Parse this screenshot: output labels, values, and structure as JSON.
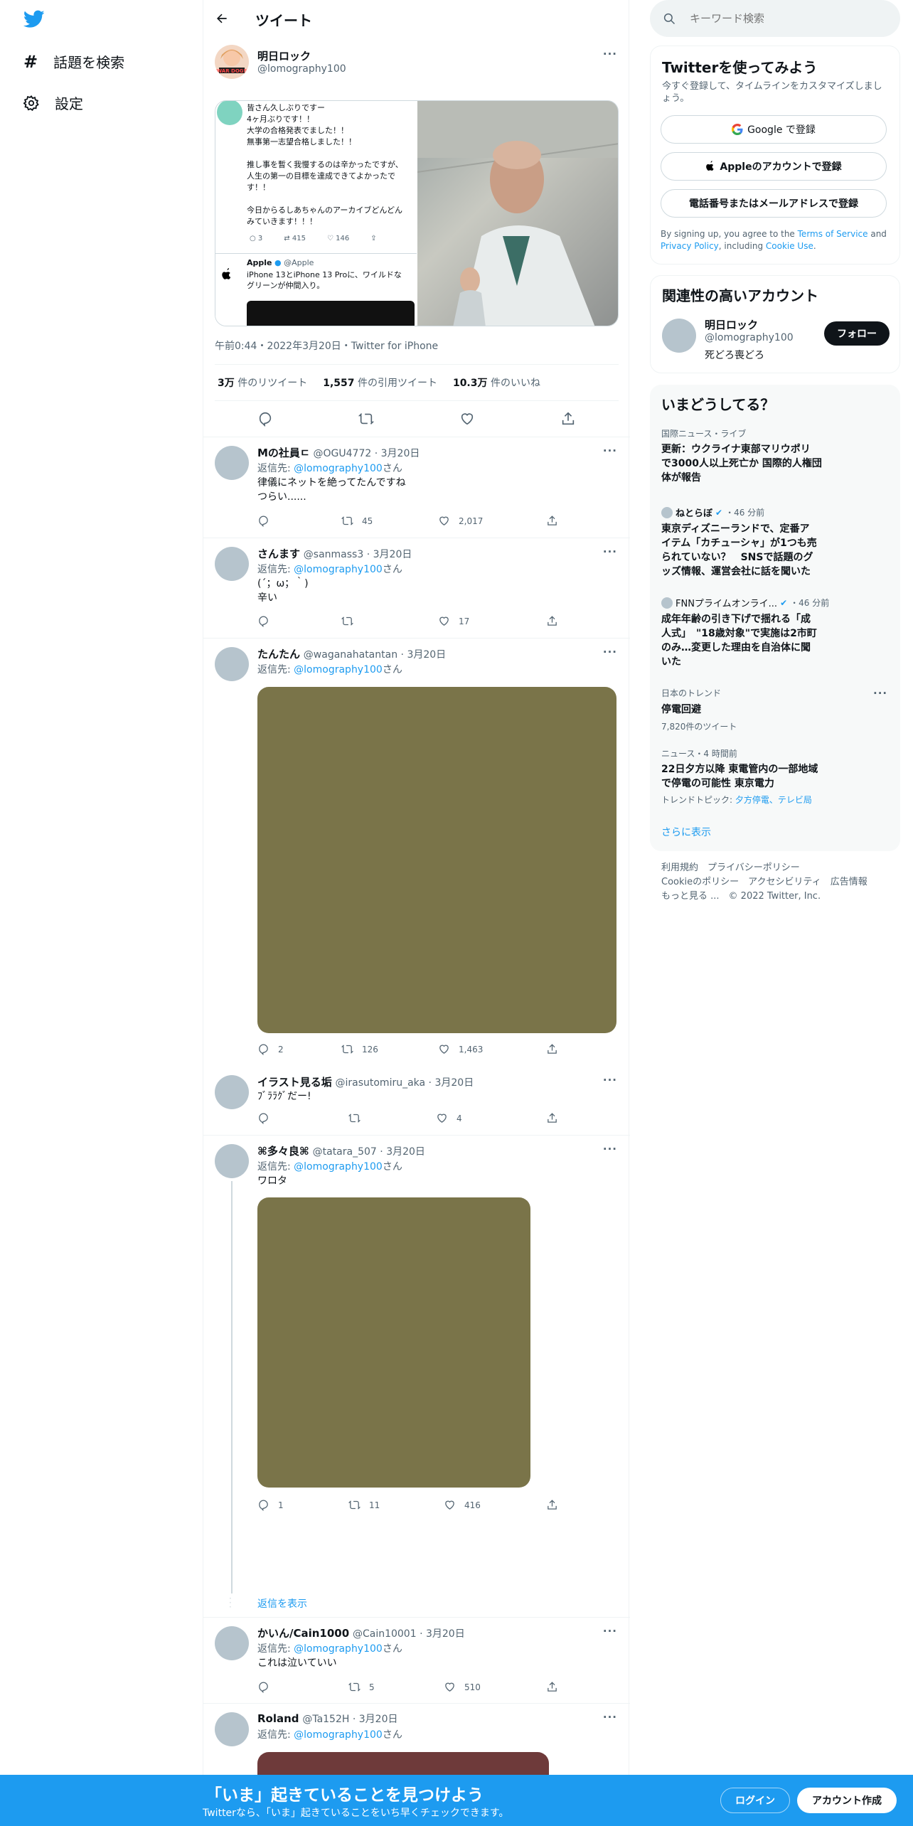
{
  "nav": {
    "explore_label": "話題を検索",
    "settings_label": "設定"
  },
  "header": {
    "title": "ツイート"
  },
  "tweet": {
    "author_name": "明日ロック",
    "author_handle": "@lomography100",
    "embedded_text": "皆さん久しぶりですー\n4ヶ月ぶりです！！\n大学の合格発表でました！！\n無事第一志望合格しました！！\n\n推し事を暫く我慢するのは辛かったですが、\n人生の第一の目標を達成できてよかったで\nす！！\n\n今日からるしあちゃんのアーカイブどんどん\nみていきます！！！",
    "embedded_counts": {
      "reply": "3",
      "retweet": "415",
      "like": "146"
    },
    "embedded_quote_name": "Apple",
    "embedded_quote_handle": "@Apple",
    "embedded_quote_text": "iPhone 13とiPhone 13 Proに、ワイルドな\nグリーンが仲間入り。",
    "meta": "午前0:44・2022年3月20日・Twitter for iPhone",
    "retweets_value": "3万",
    "retweets_label": "件のリツイート",
    "quotes_value": "1,557",
    "quotes_label": "件の引用ツイート",
    "likes_value": "10.3万",
    "likes_label": "件のいいね"
  },
  "replies": [
    {
      "name": "Mの社員ㄷ",
      "handle": "@OGU4772",
      "date": "3月20日",
      "to_prefix": "返信先: ",
      "to_handle": "@lomography100",
      "to_suffix": "さん",
      "text": "律儀にネットを絶ってたんですね\nつらい......",
      "reply_count": "",
      "retweet_count": "45",
      "like_count": "2,017"
    },
    {
      "name": "さんます",
      "handle": "@sanmass3",
      "date": "3月20日",
      "to_prefix": "返信先: ",
      "to_handle": "@lomography100",
      "to_suffix": "さん",
      "text": "(´；ω；｀)\n辛い",
      "reply_count": "",
      "retweet_count": "",
      "like_count": "17"
    },
    {
      "name": "たんたん",
      "handle": "@waganahatantan",
      "date": "3月20日",
      "to_prefix": "返信先: ",
      "to_handle": "@lomography100",
      "to_suffix": "さん",
      "text": "",
      "reply_count": "2",
      "retweet_count": "126",
      "like_count": "1,463"
    },
    {
      "name": "イラスト見る垢",
      "handle": "@irasutomiru_aka",
      "date": "3月20日",
      "to_prefix": "",
      "to_handle": "",
      "to_suffix": "",
      "text": "ﾌﾞﾗﾗｸﾞだー!",
      "reply_count": "",
      "retweet_count": "",
      "like_count": "4"
    },
    {
      "name": "⌘多々良⌘",
      "handle": "@tatara_507",
      "date": "3月20日",
      "to_prefix": "返信先: ",
      "to_handle": "@lomography100",
      "to_suffix": "さん",
      "text": "ワロタ",
      "reply_count": "1",
      "retweet_count": "11",
      "like_count": "416"
    },
    {
      "name": "かいん/Cain1000",
      "handle": "@Cain10001",
      "date": "3月20日",
      "to_prefix": "返信先: ",
      "to_handle": "@lomography100",
      "to_suffix": "さん",
      "text": "これは泣いていい",
      "reply_count": "",
      "retweet_count": "5",
      "like_count": "510"
    },
    {
      "name": "Roland",
      "handle": "@Ta152H",
      "date": "3月20日",
      "to_prefix": "返信先: ",
      "to_handle": "@lomography100",
      "to_suffix": "さん",
      "text": "",
      "reply_count": "",
      "retweet_count": "",
      "like_count": ""
    }
  ],
  "show_replies_label": "返信を表示",
  "search": {
    "placeholder": "キーワード検索"
  },
  "signup": {
    "title": "Twitterを使ってみよう",
    "subtitle": "今すぐ登録して、タイムラインをカスタマイズしましょう。",
    "google_label": "Google で登録",
    "apple_label": "Appleのアカウントで登録",
    "phone_label": "電話番号またはメールアドレスで登録",
    "terms_prefix": "By signing up, you agree to the ",
    "terms_link": "Terms of Service",
    "terms_and": " and ",
    "privacy_link": "Privacy Policy",
    "terms_including": ", including ",
    "cookie_link": "Cookie Use",
    "terms_end": "."
  },
  "related": {
    "title": "関連性の高いアカウント",
    "name": "明日ロック",
    "handle": "@lomography100",
    "bio": "死どろ喪どろ",
    "follow_label": "フォロー"
  },
  "trends": {
    "title": "いまどうしてる？",
    "items": [
      {
        "context": "国際ニュース・ライブ",
        "headline": "更新：ウクライナ東部マリウポリ\nで3000人以上死亡か 国際的人権団\n体が報告"
      },
      {
        "source": "ねとらぼ",
        "time": "・46 分前",
        "headline": "東京ディズニーランドで、定番ア\nイテム「カチューシャ」が1つも売\nられていない？　SNSで話題のグ\nッズ情報、運営会社に話を聞いた"
      },
      {
        "source": "FNNプライムオンライ...",
        "time": "・46 分前",
        "headline": "成年年齢の引き下げで揺れる「成\n人式」　\"18歳対象\"で実施は2市町\nのみ…変更した理由を自治体に聞\nいた"
      },
      {
        "context": "日本のトレンド",
        "headline": "停電回避",
        "sub": "7,820件のツイート"
      },
      {
        "context": "ニュース・4 時間前",
        "headline": "22日夕方以降 東電管内の一部地域\nで停電の可能性 東京電力",
        "topic_prefix": "トレンドトピック: ",
        "topic_links": "夕方停電、テレビ局"
      }
    ],
    "show_more": "さらに表示"
  },
  "footer": {
    "terms": "利用規約",
    "privacy": "プライバシーポリシー",
    "cookie": "Cookieのポリシー",
    "accessibility": "アクセシビリティ",
    "ads": "広告情報",
    "more": "もっと見る ...",
    "copyright": "© 2022 Twitter, Inc."
  },
  "bottombar": {
    "title": "「いま」起きていることを見つけよう",
    "subtitle": "Twitterなら、「いま」起きていることをいち早くチェックできます。",
    "login": "ログイン",
    "signup": "アカウント作成"
  },
  "colors": {
    "accent": "#1d9bf0",
    "olive_media": "#7a7449",
    "brown_media": "#6e3a3a"
  }
}
